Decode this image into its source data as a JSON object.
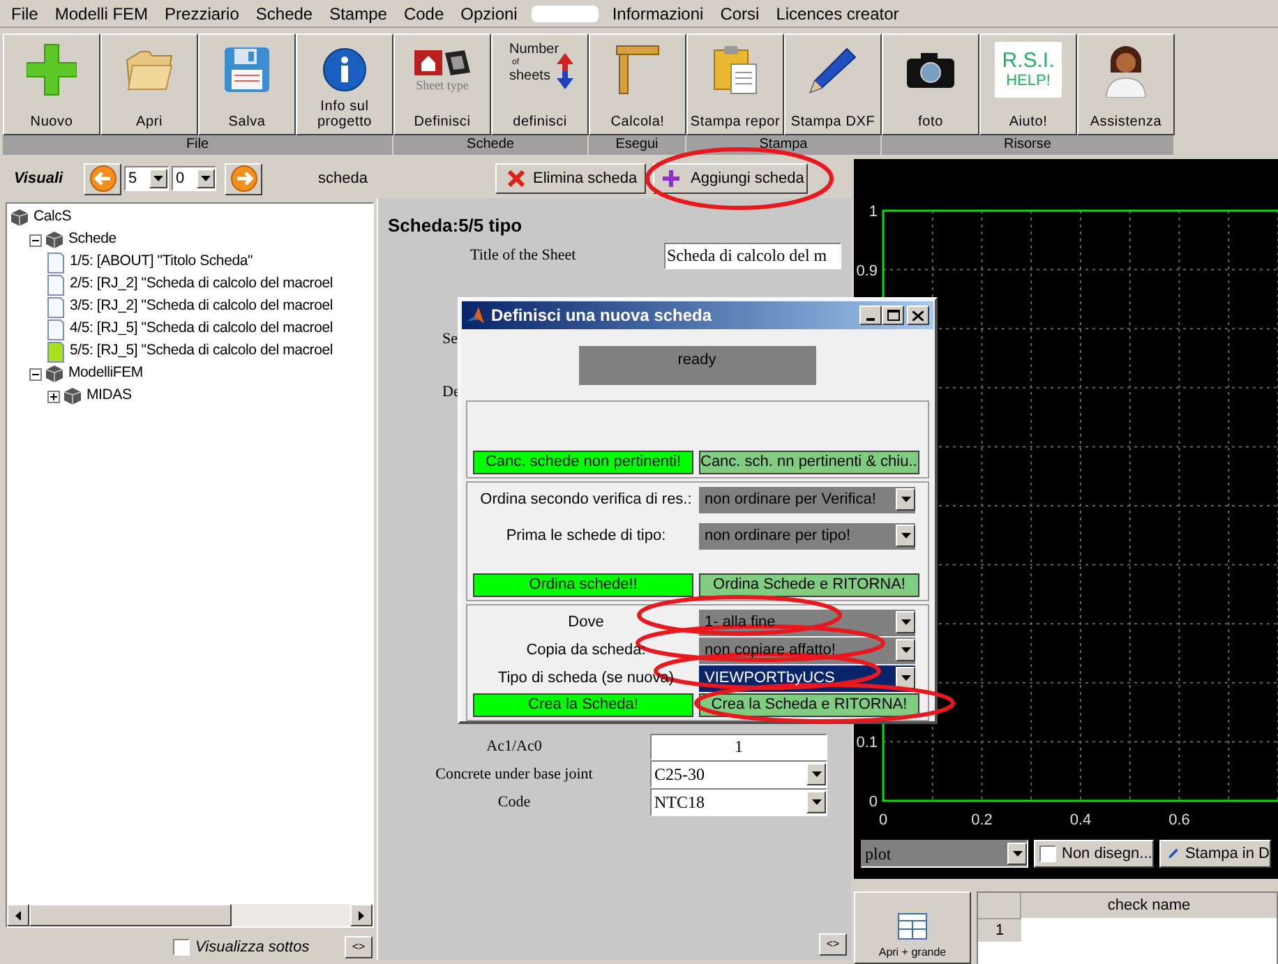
{
  "menu": [
    {
      "label": "File"
    },
    {
      "label": "Modelli FEM"
    },
    {
      "label": "Prezziario"
    },
    {
      "label": "Schede"
    },
    {
      "label": "Stampe"
    },
    {
      "label": "Code"
    },
    {
      "label": "Opzioni"
    },
    {
      "kind": "redacted"
    },
    {
      "label": "Informazioni"
    },
    {
      "label": "Corsi"
    },
    {
      "label": "Licences creator"
    }
  ],
  "toolbar": [
    {
      "group": "File",
      "buttons": [
        {
          "label": "Nuovo",
          "kind": "plus"
        },
        {
          "label": "Apri",
          "kind": "folder"
        },
        {
          "label": "Salva",
          "kind": "floppy"
        },
        {
          "label": "Info sul progetto",
          "kind": "info"
        }
      ]
    },
    {
      "group": "Schede",
      "buttons": [
        {
          "label": "Definisci",
          "kind": "sheettype",
          "icon_lines": [
            "Sheet type"
          ]
        },
        {
          "label": "definisci",
          "kind": "number",
          "icon_lines": [
            "Number",
            "of",
            "sheets"
          ]
        }
      ]
    },
    {
      "group": "Esegui",
      "buttons": [
        {
          "label": "Calcola!",
          "kind": "ruler"
        }
      ]
    },
    {
      "group": "Stampa",
      "buttons": [
        {
          "label": "Stampa repor",
          "kind": "clipboard"
        },
        {
          "label": "Stampa DXF",
          "kind": "pencil"
        }
      ]
    },
    {
      "group": "Risorse",
      "buttons": [
        {
          "label": "foto",
          "kind": "camera"
        },
        {
          "label": "Aiuto!",
          "kind": "help",
          "icon_lines": [
            "R.S.I.",
            "HELP!"
          ]
        },
        {
          "label": "Assistenza",
          "kind": "person"
        }
      ]
    }
  ],
  "navigator": {
    "label": "Visuali",
    "sheet": "5",
    "sub": "0",
    "caption": "scheda",
    "delete_button": "Elimina scheda",
    "add_button": "Aggiungi scheda"
  },
  "tree": [
    {
      "label": "CalcS",
      "kind": "cube",
      "children": [
        {
          "label": "Schede",
          "kind": "cube",
          "expanded": true,
          "children": [
            {
              "label": "1/5: [ABOUT] \"Titolo Scheda\"",
              "kind": "page",
              "selected": false
            },
            {
              "label": "2/5: [RJ_2] \"Scheda di calcolo del macroel",
              "kind": "page",
              "selected": false
            },
            {
              "label": "3/5: [RJ_2] \"Scheda di calcolo del macroel",
              "kind": "page",
              "selected": false
            },
            {
              "label": "4/5: [RJ_5] \"Scheda di calcolo del macroel",
              "kind": "page",
              "selected": false
            },
            {
              "label": "5/5: [RJ_5] \"Scheda di calcolo del macroel",
              "kind": "page",
              "selected": true
            }
          ]
        },
        {
          "label": "ModelliFEM",
          "kind": "cube",
          "expanded": true,
          "children": [
            {
              "label": "MIDAS",
              "kind": "cube",
              "expanded": false
            }
          ]
        }
      ]
    }
  ],
  "sidebar_footer": {
    "checkbox": {
      "label": "Visualizza sottos",
      "checked": false
    },
    "toggle": "<>"
  },
  "sheet_form": {
    "heading": "Scheda:5/5 tipo",
    "upper_fields": [
      {
        "label": "Title of the Sheet",
        "kind": "text",
        "value": "Scheda di calcolo del m"
      },
      {
        "label": "Se",
        "kind": "label"
      },
      {
        "label": "De",
        "kind": "label"
      }
    ],
    "lower_fields": [
      {
        "label": "Ac1/Ac0",
        "kind": "number",
        "value": "1"
      },
      {
        "label": "Concrete under base joint",
        "kind": "select",
        "value": "C25-30"
      },
      {
        "label": "Code",
        "kind": "select",
        "value": "NTC18"
      }
    ],
    "toggle": "<>"
  },
  "plot": {
    "chart_data": {
      "type": "line",
      "grid": true,
      "xlim": [
        0,
        0.8
      ],
      "ylim": [
        0,
        1
      ],
      "xticks": [
        0,
        0.2,
        0.4,
        0.6
      ],
      "yticks": [
        0,
        0.1,
        0.9,
        1
      ]
    }
  },
  "plot_controls": {
    "select": "plot",
    "checkbox": {
      "label": "Non disegn...",
      "checked": false
    },
    "print_button": "Stampa in D"
  },
  "results": {
    "open_button": "Apri + grande",
    "columns": [
      "check name"
    ],
    "rows": [
      {
        "index": "1"
      }
    ]
  },
  "dialog": {
    "title": "Definisci una nuova scheda",
    "status": "ready",
    "sections": [
      {
        "buttons": [
          {
            "label": "Canc. schede non pertinenti!",
            "kind": "primary"
          },
          {
            "label": "Canc. sch. nn pertinenti & chiu...",
            "kind": "secondary"
          }
        ]
      },
      {
        "rows": [
          {
            "label": "Ordina secondo verifica di res.:",
            "value": "non ordinare per Verifica!",
            "focused": false
          },
          {
            "label": "Prima le schede di tipo:",
            "value": "non ordinare per tipo!",
            "focused": false
          }
        ],
        "buttons": [
          {
            "label": "Ordina schede!!",
            "kind": "primary"
          },
          {
            "label": "Ordina Schede e RITORNA!",
            "kind": "secondary"
          }
        ]
      },
      {
        "rows": [
          {
            "label": "Dove",
            "value": "1- alla fine",
            "focused": false
          },
          {
            "label": "Copia da scheda:",
            "value": "non copiare affatto!",
            "focused": false
          },
          {
            "label": "Tipo di scheda (se nuova)",
            "value": "VIEWPORTbyUCS",
            "focused": true
          }
        ],
        "buttons": [
          {
            "label": "Crea la Scheda!",
            "kind": "primary"
          },
          {
            "label": "Crea la Scheda e RITORNA!",
            "kind": "secondary"
          }
        ]
      }
    ]
  }
}
